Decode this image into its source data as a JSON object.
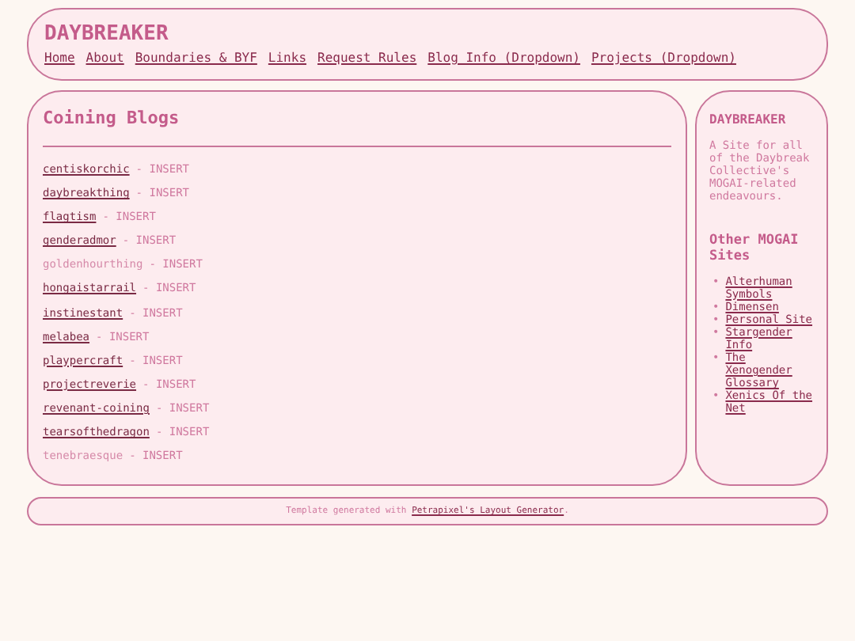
{
  "header": {
    "title": "DAYBREAKER",
    "nav": [
      "Home",
      "About",
      "Boundaries & BYF",
      "Links",
      "Request Rules",
      "Blog Info (Dropdown)",
      "Projects (Dropdown)"
    ]
  },
  "main": {
    "heading": "Coining Blogs",
    "blogs": [
      {
        "name": "centiskorchic",
        "linked": true,
        "note": "- INSERT"
      },
      {
        "name": "daybreakthing",
        "linked": true,
        "note": "- INSERT"
      },
      {
        "name": "flagtism",
        "linked": true,
        "note": "- INSERT"
      },
      {
        "name": "genderadmor",
        "linked": true,
        "note": "- INSERT"
      },
      {
        "name": "goldenhourthing",
        "linked": false,
        "note": "- INSERT"
      },
      {
        "name": "hongaistarrail",
        "linked": true,
        "note": "- INSERT"
      },
      {
        "name": "instinestant",
        "linked": true,
        "note": "- INSERT"
      },
      {
        "name": "melabea",
        "linked": true,
        "note": "- INSERT"
      },
      {
        "name": "playpercraft",
        "linked": true,
        "note": "- INSERT"
      },
      {
        "name": "projectreverie",
        "linked": true,
        "note": "- INSERT"
      },
      {
        "name": "revenant-coining",
        "linked": true,
        "note": "- INSERT"
      },
      {
        "name": "tearsofthedragon",
        "linked": true,
        "note": "- INSERT"
      },
      {
        "name": "tenebraesque",
        "linked": false,
        "note": "- INSERT"
      }
    ]
  },
  "sidebar": {
    "title": "DAYBREAKER",
    "description": "A Site for all of the Daybreak Collective's MOGAI-related endeavours.",
    "heading": "Other MOGAI Sites",
    "bullet": "•",
    "links": [
      "Alterhuman Symbols",
      "Dimensen",
      "Personal Site",
      "Stargender Info",
      "The Xenogender Glossary",
      "Xenics Of the Net"
    ]
  },
  "footer": {
    "text": "Template generated with ",
    "link": "Petrapixel's Layout Generator",
    "end": "."
  }
}
